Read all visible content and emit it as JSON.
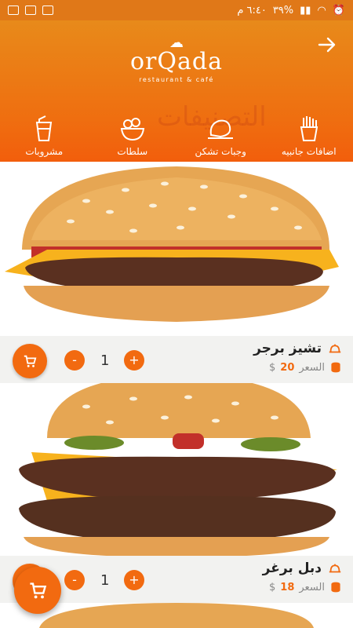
{
  "status_bar": {
    "time": "٦:٤٠ م",
    "battery": "٣٩%"
  },
  "header": {
    "logo_name": "orQada",
    "logo_tagline": "restaurant & café",
    "watermark": "التصنيفات"
  },
  "categories": [
    {
      "label": "اضافات جانبيه",
      "icon": "fries-icon"
    },
    {
      "label": "وجبات تشكن",
      "icon": "chicken-icon"
    },
    {
      "label": "سلطات",
      "icon": "salad-icon"
    },
    {
      "label": "مشروبات",
      "icon": "drink-icon"
    }
  ],
  "items": [
    {
      "title": "تشيز برجر",
      "price_label": "السعر",
      "price": "20",
      "currency": "$",
      "quantity": "1"
    },
    {
      "title": "دبل برغر",
      "price_label": "السعر",
      "price": "18",
      "currency": "$",
      "quantity": "1"
    }
  ],
  "controls": {
    "minus": "-",
    "plus": "+"
  },
  "colors": {
    "accent": "#f26a10",
    "header_top": "#e88a1a"
  }
}
